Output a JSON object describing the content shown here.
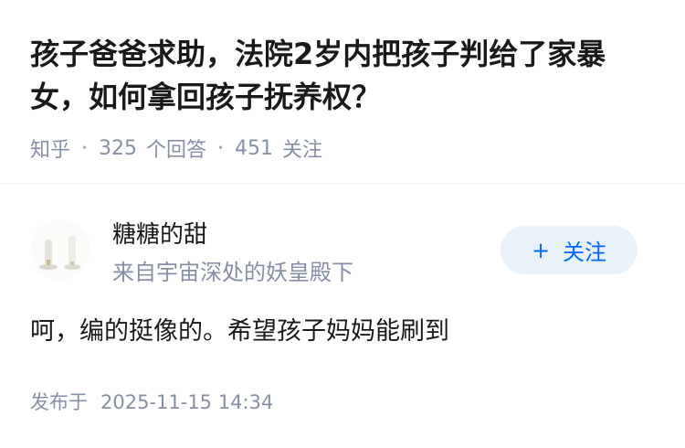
{
  "question": {
    "title": "孩子爸爸求助，法院2岁内把孩子判给了家暴女，如何拿回孩子抚养权？"
  },
  "meta": {
    "source": "知乎",
    "answer_count": "325",
    "answer_label": "个回答",
    "follow_count": "451",
    "follow_label": "关注"
  },
  "author": {
    "name": "糖糖的甜",
    "bio": "来自宇宙深处的妖皇殿下",
    "follow_button_label": "关注",
    "follow_button_icon": "plus-icon"
  },
  "answer": {
    "text": "呵，编的挺像的。希望孩子妈妈能刷到",
    "published_label": "发布于",
    "published_time": "2025-11-15 14:34"
  },
  "colors": {
    "title": "#1a1a1a",
    "meta": "#8590a6",
    "accent": "#0066ff",
    "button_bg": "#e9f1fb"
  }
}
